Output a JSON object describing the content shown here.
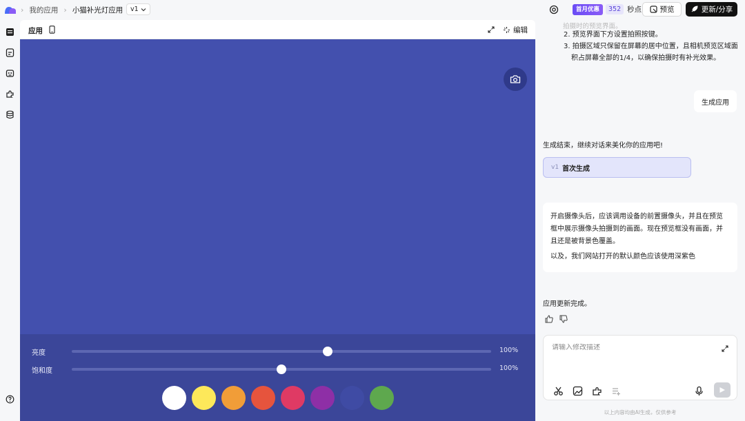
{
  "topbar": {
    "breadcrumb_home": "我的应用",
    "breadcrumb_app": "小猫补光灯应用",
    "version": "v1",
    "promo_badge": "首月优惠",
    "promo_count": "352",
    "promo_unit": "秒点",
    "preview_label": "预览",
    "share_label": "更新/分享"
  },
  "panel": {
    "title": "应用",
    "edit_label": "编辑",
    "preview_color": "#4350ae",
    "sliders": [
      {
        "label": "亮度",
        "value": "100%",
        "position": 0.61
      },
      {
        "label": "饱和度",
        "value": "100%",
        "position": 0.5
      }
    ],
    "swatches": [
      "#ffffff",
      "#fde85a",
      "#f19d38",
      "#e6543d",
      "#df3a64",
      "#8e2fa6",
      "#3f4ba4",
      "#5ea84e"
    ]
  },
  "chat": {
    "faded_text": "拍摄时的预览界面。",
    "list": [
      {
        "num": "2.",
        "text": "预览界面下方设置拍照按键。"
      },
      {
        "num": "3.",
        "text": "拍摄区域只保留在屏幕的居中位置，且相机预览区域面"
      },
      {
        "num": "",
        "text": "积占屏幕全部的1/4，以确保拍摄时有补光效果。"
      }
    ],
    "user_msg_1": "生成应用",
    "bot_msg_1": "生成结束，继续对话来美化你的应用吧!",
    "version_card": {
      "version": "v1",
      "title": "首次生成"
    },
    "user_msg_2": {
      "lines": [
        "开启摄像头后，应该调用设备的前置摄像头，并且在预览",
        "框中展示摄像头拍摄到的画面。现在预览框没有画面，并",
        "且还是被背景色覆盖。"
      ],
      "line_extra": "以及，我们网站打开的默认颜色应该使用深紫色"
    },
    "bot_msg_2": "应用更新完成。",
    "input_placeholder": "请输入修改描述",
    "disclaimer": "以上内容均由AI生成，仅供参考"
  }
}
